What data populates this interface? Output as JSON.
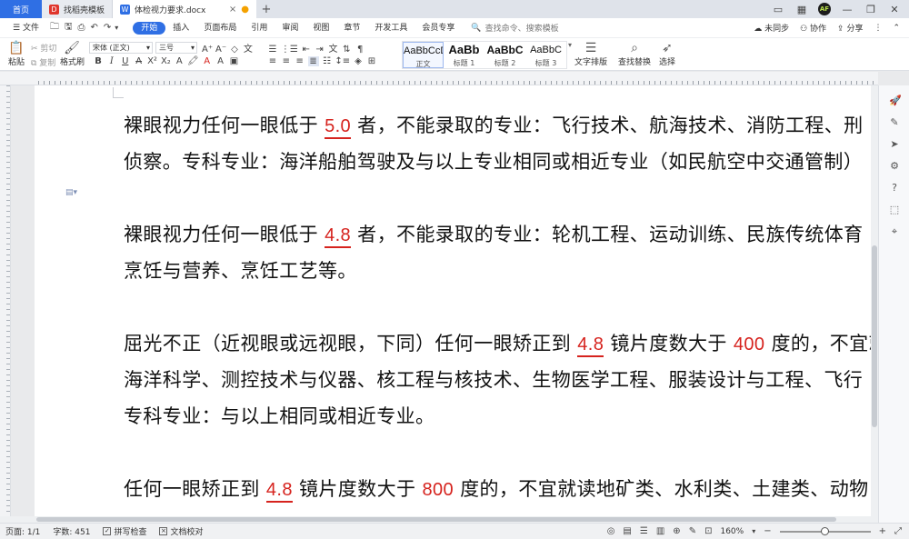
{
  "tabs": {
    "home": "首页",
    "template": "找稻壳模板",
    "document": "体检视力要求.docx"
  },
  "menu": {
    "file": "文件",
    "items": [
      "开始",
      "插入",
      "页面布局",
      "引用",
      "审阅",
      "视图",
      "章节",
      "开发工具",
      "会员专享"
    ],
    "search_placeholder": "查找命令、搜索模板",
    "sync": "未同步",
    "collab": "协作",
    "share": "分享"
  },
  "ribbon": {
    "paste": "粘贴",
    "cut": "剪切",
    "copy": "复制",
    "format_painter": "格式刷",
    "font_name": "宋体 (正文)",
    "font_size": "三号",
    "styles": [
      {
        "preview": "AaBbCcDd",
        "caption": "正文"
      },
      {
        "preview": "AaBb",
        "caption": "标题 1"
      },
      {
        "preview": "AaBbC",
        "caption": "标题 2"
      },
      {
        "preview": "AaBbC",
        "caption": "标题 3"
      }
    ],
    "text_layout": "文字排版",
    "find_replace": "查找替换",
    "select": "选择"
  },
  "document": {
    "paragraphs": [
      {
        "lines": [
          [
            {
              "t": "裸眼视力任何一眼低于 "
            },
            {
              "n": "5.0",
              "u": true
            },
            {
              "t": " 者，不能录取的专业：飞行技术、航海技术、消防工程、刑"
            }
          ],
          [
            {
              "t": "侦察。专科专业：海洋船舶驾驶及与以上专业相同或相近专业（如民航空中交通管制）"
            }
          ]
        ]
      },
      {
        "lines": [
          [
            {
              "t": "裸眼视力任何一眼低于 "
            },
            {
              "n": "4.8",
              "u": true
            },
            {
              "t": " 者，不能录取的专业：轮机工程、运动训练、民族传统体育"
            }
          ],
          [
            {
              "t": "烹饪与营养、烹饪工艺等。"
            }
          ]
        ]
      },
      {
        "lines": [
          [
            {
              "t": "屈光不正（近视眼或远视眼，下同）任何一眼矫正到 "
            },
            {
              "n": "4.8",
              "u": true
            },
            {
              "t": " 镜片度数大于 "
            },
            {
              "n": "400",
              "u": false
            },
            {
              "t": " 度的，不宜就读"
            }
          ],
          [
            {
              "t": "海洋科学、测控技术与仪器、核工程与核技术、生物医学工程、服装设计与工程、飞行"
            }
          ],
          [
            {
              "t": "专科专业：与以上相同或相近专业。"
            }
          ]
        ]
      },
      {
        "lines": [
          [
            {
              "t": "任何一眼矫正到 "
            },
            {
              "n": "4.8",
              "u": true
            },
            {
              "t": " 镜片度数大于 "
            },
            {
              "n": "800",
              "u": false
            },
            {
              "t": " 度的，不宜就读地矿类、水利类、土建类、动物"
            }
          ]
        ]
      }
    ]
  },
  "status": {
    "page": "页面: 1/1",
    "word_count": "字数: 451",
    "spell_check": "拼写检查",
    "proofread": "文档校对",
    "zoom": "160%",
    "zoom_fraction": 0.5
  },
  "colors": {
    "accent": "#2f6fe4",
    "highlight_number": "#d6231e"
  }
}
